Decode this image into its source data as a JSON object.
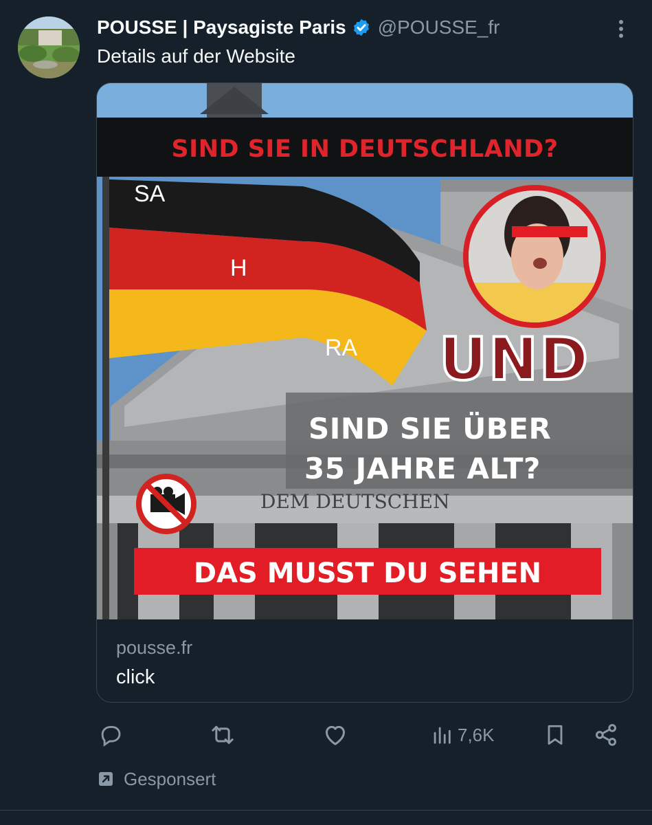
{
  "post": {
    "author_name": "POUSSE | Paysagiste Paris",
    "handle": "@POUSSE_fr",
    "text": "Details auf der Website"
  },
  "card": {
    "image_text": {
      "top_banner": "SIND SIE IN DEUTSCHLAND?",
      "flag_letters": [
        "SA",
        "H",
        "RA"
      ],
      "und": "UND",
      "question_line1": "SIND SIE ÜBER",
      "question_line2": "35 JAHRE ALT?",
      "building_inscription": "DEM DEUTSCHEN",
      "bottom_banner": "DAS MUSST DU SEHEN"
    },
    "domain": "pousse.fr",
    "title": "click"
  },
  "actions": {
    "views_count": "7,6K"
  },
  "footer": {
    "sponsored_label": "Gesponsert"
  },
  "colors": {
    "background": "#15202b",
    "text_primary": "#f7f9f9",
    "text_secondary": "#8b98a5",
    "verified": "#1d9bf0",
    "banner_red": "#e0242c",
    "und_red": "#8b1a1e"
  },
  "icons": [
    "verified-badge-icon",
    "more-icon",
    "reply-icon",
    "repost-icon",
    "like-icon",
    "views-icon",
    "bookmark-icon",
    "share-icon",
    "promoted-icon"
  ]
}
